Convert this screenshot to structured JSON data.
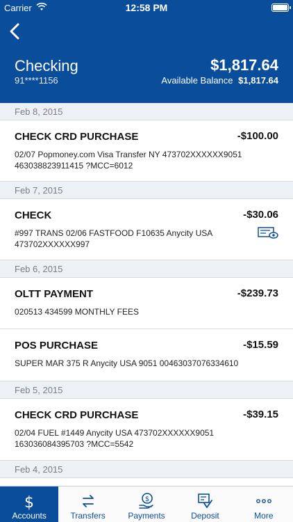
{
  "status_bar": {
    "carrier": "Carrier",
    "time": "12:58 PM"
  },
  "account": {
    "name": "Checking",
    "number": "91****1156",
    "balance": "$1,817.64",
    "available_label": "Available Balance",
    "available_value": "$1,817.64"
  },
  "groups": [
    {
      "date": "Feb 8, 2015",
      "transactions": [
        {
          "title": "CHECK CRD PURCHASE",
          "amount": "-$100.00",
          "description": "02/07 Popmoney.com Visa Transfer NY 473702XXXXXX9051 463038823911415 ?MCC=6012"
        }
      ]
    },
    {
      "date": "Feb 7, 2015",
      "transactions": [
        {
          "title": "CHECK",
          "amount": "-$30.06",
          "description": "#997 TRANS 02/06 FASTFOOD F10635 Anycity USA 473702XXXXXX997",
          "icon": "check-image-icon"
        }
      ]
    },
    {
      "date": "Feb 6, 2015",
      "transactions": [
        {
          "title": "OLTT PAYMENT",
          "amount": "-$239.73",
          "description": "020513 434599 MONTHLY FEES"
        },
        {
          "title": "POS PURCHASE",
          "amount": "-$15.59",
          "description": "SUPER MAR 375 R Anycity USA 9051 00463037076334610"
        }
      ]
    },
    {
      "date": "Feb 5, 2015",
      "transactions": [
        {
          "title": "CHECK CRD PURCHASE",
          "amount": "-$39.15",
          "description": "02/04 FUEL #1449 Anycity USA 473702XXXXXX9051 163036084395703 ?MCC=5542"
        }
      ]
    },
    {
      "date": "Feb 4, 2015",
      "transactions": []
    }
  ],
  "tabs": [
    {
      "label": "Accounts",
      "icon": "dollar-icon",
      "active": true
    },
    {
      "label": "Transfers",
      "icon": "transfer-arrows-icon",
      "active": false
    },
    {
      "label": "Payments",
      "icon": "payments-icon",
      "active": false
    },
    {
      "label": "Deposit",
      "icon": "check-deposit-icon",
      "active": false
    },
    {
      "label": "More",
      "icon": "more-dots-icon",
      "active": false
    }
  ],
  "colors": {
    "brand": "#0a4d9b",
    "date_header_bg": "#edf0f4"
  }
}
